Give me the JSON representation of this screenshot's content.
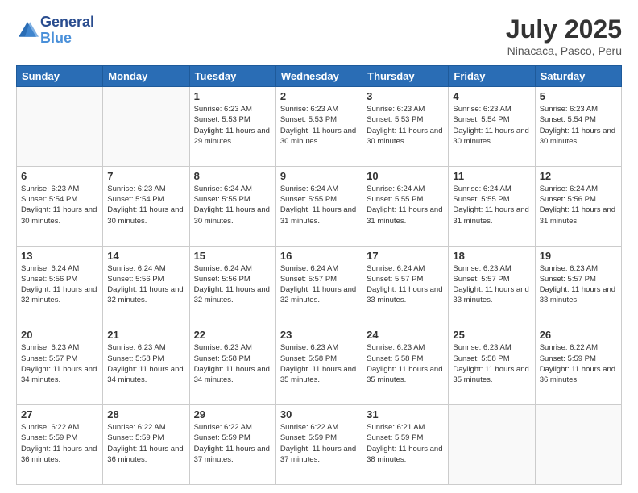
{
  "header": {
    "logo_line1": "General",
    "logo_line2": "Blue",
    "title": "July 2025",
    "subtitle": "Ninacaca, Pasco, Peru"
  },
  "days_of_week": [
    "Sunday",
    "Monday",
    "Tuesday",
    "Wednesday",
    "Thursday",
    "Friday",
    "Saturday"
  ],
  "weeks": [
    [
      {
        "day": "",
        "info": ""
      },
      {
        "day": "",
        "info": ""
      },
      {
        "day": "1",
        "info": "Sunrise: 6:23 AM\nSunset: 5:53 PM\nDaylight: 11 hours and 29 minutes."
      },
      {
        "day": "2",
        "info": "Sunrise: 6:23 AM\nSunset: 5:53 PM\nDaylight: 11 hours and 30 minutes."
      },
      {
        "day": "3",
        "info": "Sunrise: 6:23 AM\nSunset: 5:53 PM\nDaylight: 11 hours and 30 minutes."
      },
      {
        "day": "4",
        "info": "Sunrise: 6:23 AM\nSunset: 5:54 PM\nDaylight: 11 hours and 30 minutes."
      },
      {
        "day": "5",
        "info": "Sunrise: 6:23 AM\nSunset: 5:54 PM\nDaylight: 11 hours and 30 minutes."
      }
    ],
    [
      {
        "day": "6",
        "info": "Sunrise: 6:23 AM\nSunset: 5:54 PM\nDaylight: 11 hours and 30 minutes."
      },
      {
        "day": "7",
        "info": "Sunrise: 6:23 AM\nSunset: 5:54 PM\nDaylight: 11 hours and 30 minutes."
      },
      {
        "day": "8",
        "info": "Sunrise: 6:24 AM\nSunset: 5:55 PM\nDaylight: 11 hours and 30 minutes."
      },
      {
        "day": "9",
        "info": "Sunrise: 6:24 AM\nSunset: 5:55 PM\nDaylight: 11 hours and 31 minutes."
      },
      {
        "day": "10",
        "info": "Sunrise: 6:24 AM\nSunset: 5:55 PM\nDaylight: 11 hours and 31 minutes."
      },
      {
        "day": "11",
        "info": "Sunrise: 6:24 AM\nSunset: 5:55 PM\nDaylight: 11 hours and 31 minutes."
      },
      {
        "day": "12",
        "info": "Sunrise: 6:24 AM\nSunset: 5:56 PM\nDaylight: 11 hours and 31 minutes."
      }
    ],
    [
      {
        "day": "13",
        "info": "Sunrise: 6:24 AM\nSunset: 5:56 PM\nDaylight: 11 hours and 32 minutes."
      },
      {
        "day": "14",
        "info": "Sunrise: 6:24 AM\nSunset: 5:56 PM\nDaylight: 11 hours and 32 minutes."
      },
      {
        "day": "15",
        "info": "Sunrise: 6:24 AM\nSunset: 5:56 PM\nDaylight: 11 hours and 32 minutes."
      },
      {
        "day": "16",
        "info": "Sunrise: 6:24 AM\nSunset: 5:57 PM\nDaylight: 11 hours and 32 minutes."
      },
      {
        "day": "17",
        "info": "Sunrise: 6:24 AM\nSunset: 5:57 PM\nDaylight: 11 hours and 33 minutes."
      },
      {
        "day": "18",
        "info": "Sunrise: 6:23 AM\nSunset: 5:57 PM\nDaylight: 11 hours and 33 minutes."
      },
      {
        "day": "19",
        "info": "Sunrise: 6:23 AM\nSunset: 5:57 PM\nDaylight: 11 hours and 33 minutes."
      }
    ],
    [
      {
        "day": "20",
        "info": "Sunrise: 6:23 AM\nSunset: 5:57 PM\nDaylight: 11 hours and 34 minutes."
      },
      {
        "day": "21",
        "info": "Sunrise: 6:23 AM\nSunset: 5:58 PM\nDaylight: 11 hours and 34 minutes."
      },
      {
        "day": "22",
        "info": "Sunrise: 6:23 AM\nSunset: 5:58 PM\nDaylight: 11 hours and 34 minutes."
      },
      {
        "day": "23",
        "info": "Sunrise: 6:23 AM\nSunset: 5:58 PM\nDaylight: 11 hours and 35 minutes."
      },
      {
        "day": "24",
        "info": "Sunrise: 6:23 AM\nSunset: 5:58 PM\nDaylight: 11 hours and 35 minutes."
      },
      {
        "day": "25",
        "info": "Sunrise: 6:23 AM\nSunset: 5:58 PM\nDaylight: 11 hours and 35 minutes."
      },
      {
        "day": "26",
        "info": "Sunrise: 6:22 AM\nSunset: 5:59 PM\nDaylight: 11 hours and 36 minutes."
      }
    ],
    [
      {
        "day": "27",
        "info": "Sunrise: 6:22 AM\nSunset: 5:59 PM\nDaylight: 11 hours and 36 minutes."
      },
      {
        "day": "28",
        "info": "Sunrise: 6:22 AM\nSunset: 5:59 PM\nDaylight: 11 hours and 36 minutes."
      },
      {
        "day": "29",
        "info": "Sunrise: 6:22 AM\nSunset: 5:59 PM\nDaylight: 11 hours and 37 minutes."
      },
      {
        "day": "30",
        "info": "Sunrise: 6:22 AM\nSunset: 5:59 PM\nDaylight: 11 hours and 37 minutes."
      },
      {
        "day": "31",
        "info": "Sunrise: 6:21 AM\nSunset: 5:59 PM\nDaylight: 11 hours and 38 minutes."
      },
      {
        "day": "",
        "info": ""
      },
      {
        "day": "",
        "info": ""
      }
    ]
  ]
}
